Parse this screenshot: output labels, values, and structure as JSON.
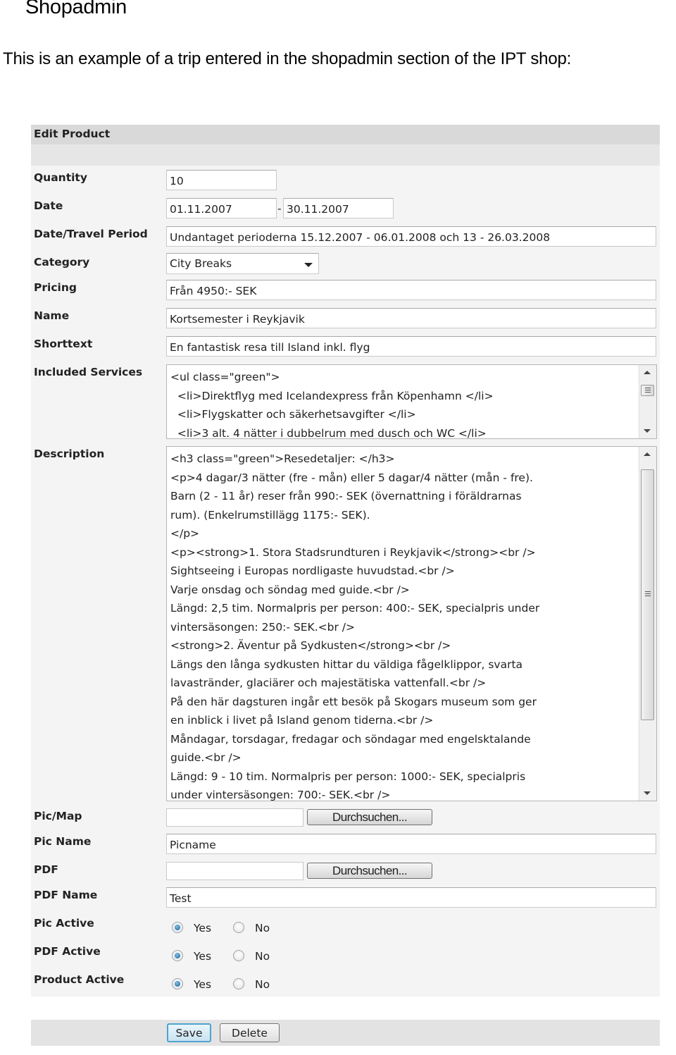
{
  "document": {
    "title": "Shopadmin",
    "intro": "This is an example of a trip entered in the shopadmin section of the IPT shop:"
  },
  "form": {
    "header": "Edit Product",
    "labels": {
      "quantity": "Quantity",
      "date": "Date",
      "travel_period": "Date/Travel Period",
      "category": "Category",
      "pricing": "Pricing",
      "name": "Name",
      "shorttext": "Shorttext",
      "included_services": "Included Services",
      "description": "Description",
      "pic_map": "Pic/Map",
      "pic_name": "Pic Name",
      "pdf": "PDF",
      "pdf_name": "PDF Name",
      "pic_active": "Pic Active",
      "pdf_active": "PDF Active",
      "product_active": "Product Active"
    },
    "values": {
      "quantity": "10",
      "date_from": "01.11.2007",
      "date_separator": "-",
      "date_to": "30.11.2007",
      "travel_period": "Undantaget perioderna 15.12.2007 - 06.01.2008 och 13 - 26.03.2008",
      "category": "City Breaks",
      "pricing": "Från 4950:- SEK",
      "name": "Kortsemester i Reykjavik",
      "shorttext": "En fantastisk resa till Island inkl. flyg",
      "pic_map": "",
      "pic_name": "Picname",
      "pdf": "",
      "pdf_name": "Test"
    },
    "included_services_lines": [
      "<ul class=\"green\">",
      "  <li>Direktflyg med Icelandexpress från Köpenhamn </li>",
      "  <li>Flygskatter och säkerhetsavgifter </li>",
      "  <li>3 alt. 4 nätter i dubbelrum med dusch och WC </li>"
    ],
    "description_lines": [
      "<h3 class=\"green\">Resedetaljer: </h3>",
      "<p>4 dagar/3 nätter (fre - mån) eller 5 dagar/4 nätter (mån - fre).",
      "Barn (2 - 11 år) reser från 990:- SEK (övernattning i föräldrarnas",
      "rum). (Enkelrumstillägg 1175:- SEK).",
      "</p>",
      "<p><strong>1. Stora Stadsrundturen i Reykjavik</strong><br />",
      "Sightseeing i Europas nordligaste huvudstad.<br />",
      "Varje onsdag och söndag med guide.<br />",
      "Längd: 2,5 tim. Normalpris per person: 400:- SEK, specialpris under",
      "vintersäsongen: 250:- SEK.<br />",
      "<strong>2. Äventur på Sydkusten</strong><br />",
      "Längs den långa sydkusten hittar du väldiga fågelklippor, svarta",
      "lavastränder, glaciärer och majestätiska vattenfall.<br />",
      "På den här dagsturen ingår ett besök på Skogars museum som ger",
      "en inblick i livet på Island genom tiderna.<br />",
      "Måndagar, torsdagar, fredagar och söndagar med engelsktalande",
      "guide.<br />",
      "Längd: 9 - 10 tim. Normalpris per person: 1000:- SEK, specialpris",
      "under vintersäsongen: 700:- SEK.<br />"
    ],
    "browse_label": "Durchsuchen...",
    "radio_yes": "Yes",
    "radio_no": "No",
    "pic_active": "Yes",
    "pdf_active": "Yes",
    "product_active": "Yes",
    "save_label": "Save",
    "delete_label": "Delete",
    "icons": {
      "select_arrow": "chevron-down-icon",
      "scroll_up": "arrow-up-icon",
      "scroll_down": "arrow-down-icon"
    }
  }
}
